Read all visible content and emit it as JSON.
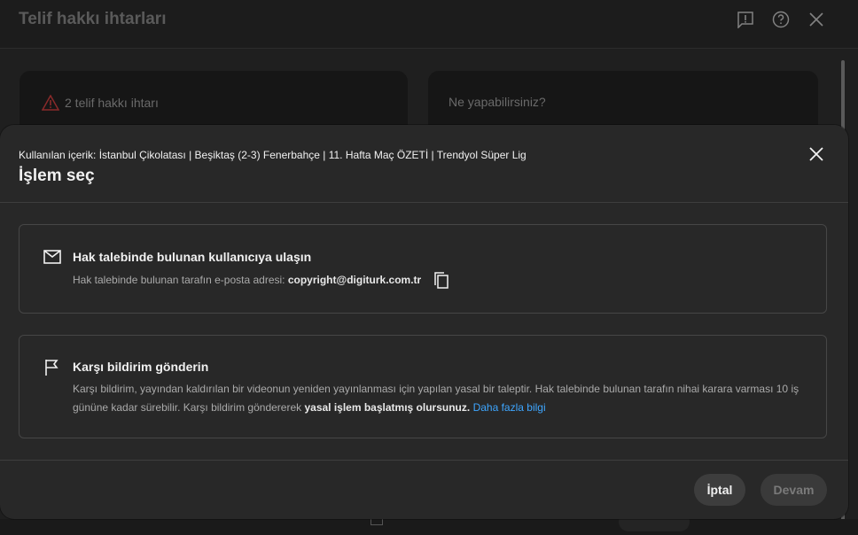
{
  "background": {
    "title": "Telif hakkı ihtarları",
    "strikes_label": "2 telif hakkı ihtarı",
    "what_can_label": "Ne yapabilirsiniz?"
  },
  "dialog": {
    "subtitle": "Kullanılan içerik: İstanbul Çikolatası | Beşiktaş (2-3) Fenerbahçe | 11. Hafta Maç ÖZETİ | Trendyol Süper Lig",
    "title": "İşlem seç",
    "options": [
      {
        "icon": "mail-icon",
        "title": "Hak talebinde bulunan kullanıcıya ulaşın",
        "desc_prefix": "Hak talebinde bulunan tarafın e-posta adresi: ",
        "email": "copyright@digiturk.com.tr"
      },
      {
        "icon": "flag-icon",
        "title": "Karşı bildirim gönderin",
        "desc_main": "Karşı bildirim, yayından kaldırılan bir videonun yeniden yayınlanması için yapılan yasal bir taleptir. Hak talebinde bulunan tarafın nihai karara varması 10 iş gününe kadar sürebilir. Karşı bildirim göndererek ",
        "desc_bold": "yasal işlem başlatmış olursunuz.",
        "link": "Daha fazla bilgi"
      }
    ],
    "cancel_label": "İptal",
    "continue_label": "Devam"
  },
  "colors": {
    "dialog_bg": "#282828",
    "link": "#3ea6ff",
    "warning": "#c0392b"
  }
}
